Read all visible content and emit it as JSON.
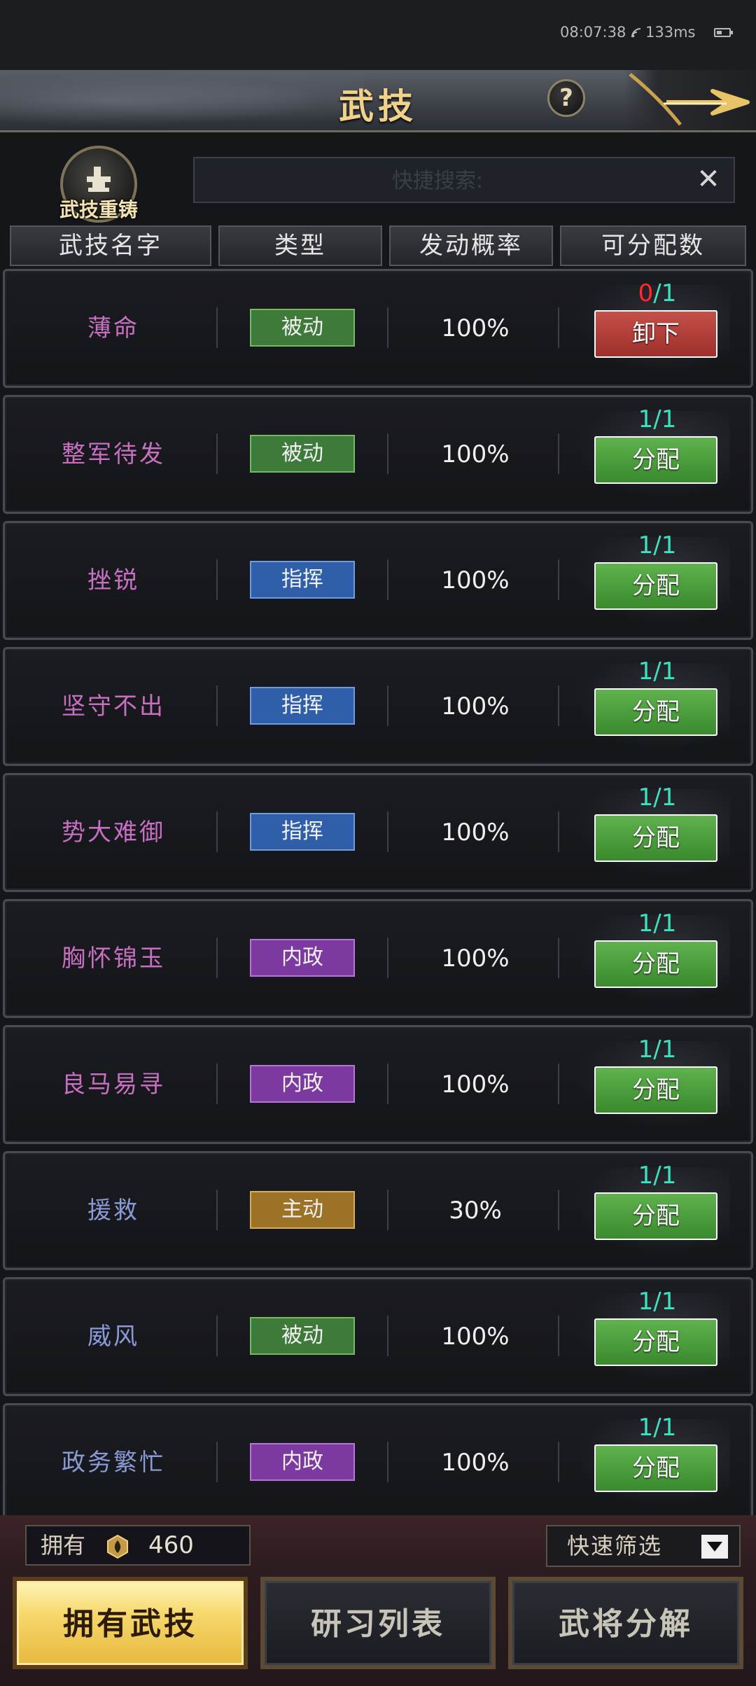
{
  "status_bar": {
    "time": "08:07:38",
    "latency": "133ms"
  },
  "header": {
    "title": "武技",
    "help_symbol": "?"
  },
  "toolbar": {
    "recast_label": "武技重铸",
    "search_placeholder": "快捷搜索:",
    "clear_symbol": "✕"
  },
  "columns": [
    "武技名字",
    "类型",
    "发动概率",
    "可分配数"
  ],
  "colors": {
    "skill_name_pink": "#c76fc0",
    "skill_name_blue": "#8a9ad6",
    "type_passive": "#3e7a3a",
    "type_command": "#2f5fa8",
    "type_internal": "#7c3aa0",
    "type_active": "#9b7226",
    "count_teal": "#3ee0c0",
    "count_red": "#ff2a2a"
  },
  "skills": [
    {
      "name": "薄命",
      "name_color": "pink",
      "type": "被动",
      "type_key": "passive",
      "rate": "100%",
      "used": "0",
      "total": "/1",
      "used_color": "red",
      "action": "卸下",
      "action_style": "red"
    },
    {
      "name": "整军待发",
      "name_color": "pink",
      "type": "被动",
      "type_key": "passive",
      "rate": "100%",
      "used": "1",
      "total": "/1",
      "used_color": "teal",
      "action": "分配",
      "action_style": "green"
    },
    {
      "name": "挫锐",
      "name_color": "pink",
      "type": "指挥",
      "type_key": "command",
      "rate": "100%",
      "used": "1",
      "total": "/1",
      "used_color": "teal",
      "action": "分配",
      "action_style": "green"
    },
    {
      "name": "坚守不出",
      "name_color": "pink",
      "type": "指挥",
      "type_key": "command",
      "rate": "100%",
      "used": "1",
      "total": "/1",
      "used_color": "teal",
      "action": "分配",
      "action_style": "green"
    },
    {
      "name": "势大难御",
      "name_color": "pink",
      "type": "指挥",
      "type_key": "command",
      "rate": "100%",
      "used": "1",
      "total": "/1",
      "used_color": "teal",
      "action": "分配",
      "action_style": "green"
    },
    {
      "name": "胸怀锦玉",
      "name_color": "pink",
      "type": "内政",
      "type_key": "internal",
      "rate": "100%",
      "used": "1",
      "total": "/1",
      "used_color": "teal",
      "action": "分配",
      "action_style": "green"
    },
    {
      "name": "良马易寻",
      "name_color": "pink",
      "type": "内政",
      "type_key": "internal",
      "rate": "100%",
      "used": "1",
      "total": "/1",
      "used_color": "teal",
      "action": "分配",
      "action_style": "green"
    },
    {
      "name": "援救",
      "name_color": "blue",
      "type": "主动",
      "type_key": "active",
      "rate": "30%",
      "used": "1",
      "total": "/1",
      "used_color": "teal",
      "action": "分配",
      "action_style": "green"
    },
    {
      "name": "威风",
      "name_color": "blue",
      "type": "被动",
      "type_key": "passive",
      "rate": "100%",
      "used": "1",
      "total": "/1",
      "used_color": "teal",
      "action": "分配",
      "action_style": "green"
    },
    {
      "name": "政务繁忙",
      "name_color": "blue",
      "type": "内政",
      "type_key": "internal",
      "rate": "100%",
      "used": "1",
      "total": "/1",
      "used_color": "teal",
      "action": "分配",
      "action_style": "green"
    }
  ],
  "footer": {
    "owned_label": "拥有",
    "owned_value": "460",
    "filter_label": "快速筛选",
    "tabs": [
      "拥有武技",
      "研习列表",
      "武将分解"
    ],
    "active_tab": 0
  }
}
